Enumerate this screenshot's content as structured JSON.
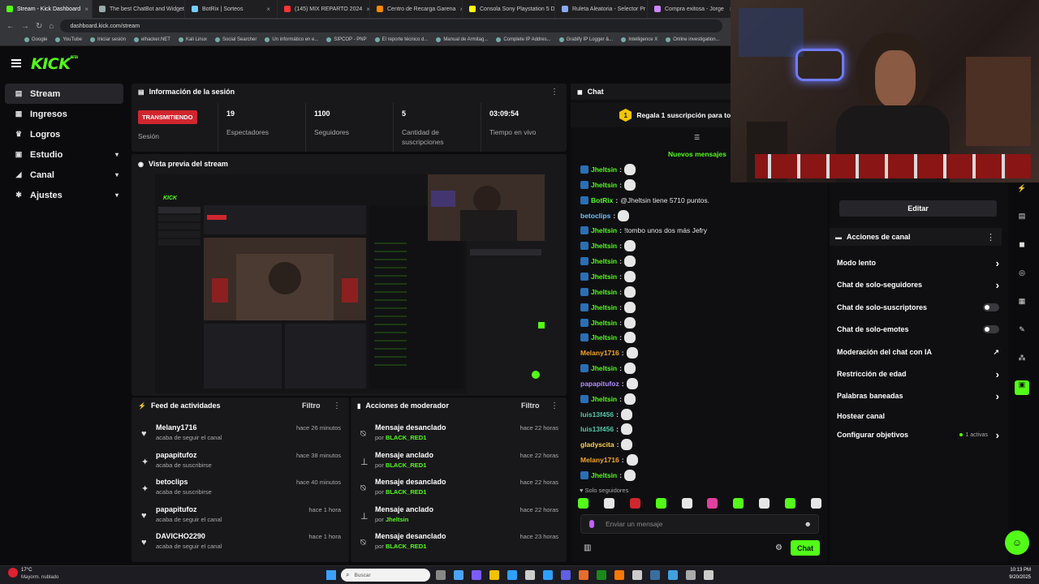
{
  "browser": {
    "tabs": [
      {
        "label": "Stream - Kick Dashboard",
        "color": "#53fc18",
        "active": true
      },
      {
        "label": "The best ChatBot and Widgets",
        "color": "#9aa"
      },
      {
        "label": "BotRix | Sorteos",
        "color": "#7cf"
      },
      {
        "label": "(145) MIX REPARTO 2024",
        "color": "#f33"
      },
      {
        "label": "Centro de Recarga Garena",
        "color": "#f80"
      },
      {
        "label": "Consola Sony Playstation 5 D",
        "color": "#ff0"
      },
      {
        "label": "Ruleta Aleatoria - Selector Pr",
        "color": "#8af"
      },
      {
        "label": "Compra exitosa - Jorge",
        "color": "#c8f"
      }
    ],
    "url": "dashboard.kick.com/stream",
    "bookmarks": [
      "Google",
      "YouTube",
      "Iniciar sesión",
      "elhacker.NET",
      "Kali Linux",
      "Social Searcher",
      "Un informático en e...",
      "SIPCOP - PNP",
      "El reporte técnico d...",
      "Manual de Armitag...",
      "Complete IP Addres...",
      "Grabify IP Logger &...",
      "Intelligence X",
      "Online investigation..."
    ]
  },
  "kick": {
    "logo": "KICK",
    "logo_tag": "BETA",
    "sidebar": [
      {
        "label": "Stream",
        "icon": "stream-icon",
        "glyph": "▤",
        "active": true
      },
      {
        "label": "Ingresos",
        "icon": "revenue-icon",
        "glyph": "▦"
      },
      {
        "label": "Logros",
        "icon": "trophy-icon",
        "glyph": "♛"
      },
      {
        "label": "Estudio",
        "icon": "studio-icon",
        "glyph": "▣",
        "chevron": true
      },
      {
        "label": "Canal",
        "icon": "channel-icon",
        "glyph": "◢",
        "chevron": true
      },
      {
        "label": "Ajustes",
        "icon": "settings-icon",
        "glyph": "✱",
        "chevron": true
      }
    ]
  },
  "session": {
    "title": "Información de la sesión",
    "status": "TRANSMITIENDO",
    "status_label": "Sesión",
    "stats": [
      {
        "value": "19",
        "label": "Espectadores"
      },
      {
        "value": "1100",
        "label": "Seguidores"
      },
      {
        "value": "5",
        "label": "Cantidad de suscripciones"
      },
      {
        "value": "03:09:54",
        "label": "Tiempo en vivo"
      }
    ]
  },
  "preview": {
    "title": "Vista previa del stream"
  },
  "feed": {
    "title": "Feed de actividades",
    "filter": "Filtro",
    "items": [
      {
        "name": "Melany1716",
        "sub": "acaba de seguir el canal",
        "time": "hace 26 minutos",
        "icon": "heart-icon",
        "glyph": "♥"
      },
      {
        "name": "papapitufoz",
        "sub": "acaba de suscribirse",
        "time": "hace 38 minutos",
        "icon": "star-icon",
        "glyph": "✦"
      },
      {
        "name": "betoclips",
        "sub": "acaba de suscribirse",
        "time": "hace 40 minutos",
        "icon": "star-icon",
        "glyph": "✦"
      },
      {
        "name": "papapitufoz",
        "sub": "acaba de seguir el canal",
        "time": "hace 1 hora",
        "icon": "heart-icon",
        "glyph": "♥"
      },
      {
        "name": "DAVICHO2290",
        "sub": "acaba de seguir el canal",
        "time": "hace 1 hora",
        "icon": "heart-icon",
        "glyph": "♥"
      }
    ]
  },
  "moderator": {
    "title": "Acciones de moderador",
    "filter": "Filtro",
    "by": "por",
    "items": [
      {
        "action": "Mensaje desanclado",
        "by": "BLACK_RED1",
        "time": "hace 22 horas",
        "icon": "unpin-icon",
        "glyph": "⍉"
      },
      {
        "action": "Mensaje anclado",
        "by": "BLACK_RED1",
        "time": "hace 22 horas",
        "icon": "pin-icon",
        "glyph": "⊥"
      },
      {
        "action": "Mensaje desanclado",
        "by": "BLACK_RED1",
        "time": "hace 22 horas",
        "icon": "unpin-icon",
        "glyph": "⍉"
      },
      {
        "action": "Mensaje anclado",
        "by": "Jheltsin",
        "time": "hace 22 horas",
        "icon": "pin-icon",
        "glyph": "⊥"
      },
      {
        "action": "Mensaje desanclado",
        "by": "BLACK_RED1",
        "time": "hace 23 horas",
        "icon": "unpin-icon",
        "glyph": "⍉"
      }
    ]
  },
  "chat": {
    "title": "Chat",
    "gift_banner": "Regala 1 suscripción para ton",
    "gift_count": "1",
    "new_messages": "Nuevos mensajes",
    "followers_only": "Solo seguidores",
    "input_placeholder": "Enviar un mensaje",
    "send": "Chat",
    "messages": [
      {
        "user": "Jheltsin",
        "color": "#53fc18",
        "text": "",
        "emote": true
      },
      {
        "user": "Jheltsin",
        "color": "#53fc18",
        "text": "",
        "emote": true
      },
      {
        "user": "BotRix",
        "color": "#53fc18",
        "text": "@Jheltsin tiene 5710 puntos.",
        "emote": false
      },
      {
        "user": "betoclips",
        "color": "#6fc3ff",
        "text": "",
        "emote": true
      },
      {
        "user": "Jheltsin",
        "color": "#53fc18",
        "text": "!tombo unos dos más Jefry",
        "emote": false
      },
      {
        "user": "Jheltsin",
        "color": "#53fc18",
        "text": "",
        "emote": true
      },
      {
        "user": "Jheltsin",
        "color": "#53fc18",
        "text": "",
        "emote": true
      },
      {
        "user": "Jheltsin",
        "color": "#53fc18",
        "text": "",
        "emote": true
      },
      {
        "user": "Jheltsin",
        "color": "#53fc18",
        "text": "",
        "emote": true
      },
      {
        "user": "Jheltsin",
        "color": "#53fc18",
        "text": "",
        "emote": true
      },
      {
        "user": "Jheltsin",
        "color": "#53fc18",
        "text": "",
        "emote": true
      },
      {
        "user": "Jheltsin",
        "color": "#53fc18",
        "text": "",
        "emote": true
      },
      {
        "user": "Melany1716",
        "color": "#f5a623",
        "text": "",
        "emote": true
      },
      {
        "user": "Jheltsin",
        "color": "#53fc18",
        "text": "",
        "emote": true
      },
      {
        "user": "papapitufoz",
        "color": "#b58cff",
        "text": "",
        "emote": true
      },
      {
        "user": "Jheltsin",
        "color": "#53fc18",
        "text": "",
        "emote": true
      },
      {
        "user": "luis13f456",
        "color": "#53c8a8",
        "text": "",
        "emote": true
      },
      {
        "user": "luis13f456",
        "color": "#53c8a8",
        "text": "",
        "emote": true
      },
      {
        "user": "gladyscita",
        "color": "#ffd24a",
        "text": "",
        "emote": true
      },
      {
        "user": "Melany1716",
        "color": "#f5a623",
        "text": "",
        "emote": true
      },
      {
        "user": "Jheltsin",
        "color": "#53fc18",
        "text": "",
        "emote": true
      }
    ]
  },
  "channel_actions": {
    "edit": "Editar",
    "title": "Acciones de canal",
    "items": [
      {
        "label": "Modo lento",
        "type": "arrow"
      },
      {
        "label": "Chat de solo-seguidores",
        "type": "arrow"
      },
      {
        "label": "Chat de solo-suscriptores",
        "type": "toggle"
      },
      {
        "label": "Chat de solo-emotes",
        "type": "toggle"
      },
      {
        "label": "Moderación del chat con IA",
        "type": "chart"
      },
      {
        "label": "Restricción de edad",
        "type": "arrow"
      },
      {
        "label": "Palabras baneadas",
        "type": "arrow"
      },
      {
        "label": "Hostear canal",
        "type": "none"
      },
      {
        "label": "Configurar objetivos",
        "type": "arrow",
        "extra": "1 activas"
      }
    ]
  },
  "taskbar": {
    "weather_temp": "17°C",
    "weather_desc": "Mayorm. nublado",
    "search": "Buscar",
    "time": "10:13 PM",
    "date": "9/20/2025"
  }
}
